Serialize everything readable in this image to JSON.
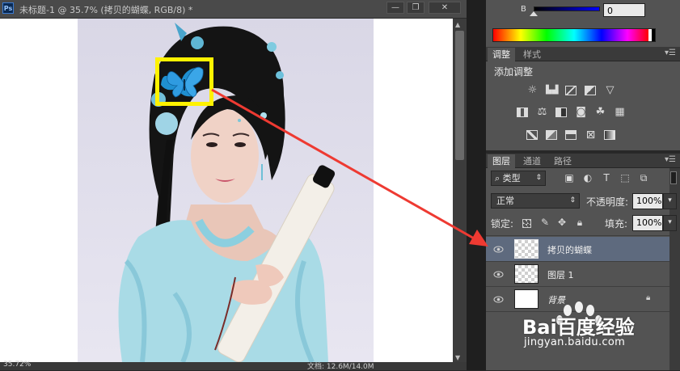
{
  "document": {
    "app_badge": "Ps",
    "title": "未标题-1 @ 35.7% (拷贝的蝴蝶, RGB/8) *",
    "window_buttons": [
      "—",
      "❐",
      "✕"
    ],
    "status_zoom": "35.72%",
    "status_info": "文档: 12.6M/14.0M"
  },
  "color_panel": {
    "channel_label": "B",
    "channel_value": "0"
  },
  "adjustments": {
    "tabs": [
      "调整",
      "样式"
    ],
    "title": "添加调整",
    "icons": [
      "brightness-icon",
      "levels-icon",
      "curves-icon",
      "exposure-icon",
      "vibrance-icon",
      "hue-saturation-icon",
      "color-balance-icon",
      "black-white-icon",
      "photo-filter-icon",
      "channel-mixer-icon",
      "color-lookup-icon",
      "invert-icon",
      "posterize-icon",
      "threshold-icon",
      "selective-color-icon",
      "gradient-map-icon"
    ]
  },
  "layers_panel": {
    "tabs": [
      "图层",
      "通道",
      "路径"
    ],
    "filter_label": "类型",
    "blend_mode": "正常",
    "opacity_label": "不透明度:",
    "opacity_value": "100%",
    "lock_label": "锁定:",
    "fill_label": "填充:",
    "fill_value": "100%",
    "layers": [
      {
        "name": "拷贝的蝴蝶",
        "selected": true,
        "thumb": "transparent"
      },
      {
        "name": "图层 1",
        "selected": false,
        "thumb": "transparent"
      },
      {
        "name": "背景",
        "selected": false,
        "thumb": "white",
        "locked": true
      }
    ]
  },
  "watermark": {
    "brand": "Bai百度经验",
    "url": "jingyan.baidu.com"
  },
  "colors": {
    "highlight_box": "#fff200",
    "arrow": "#ee3a32",
    "selected_layer": "#5e6a7e",
    "panel_bg": "#535353"
  }
}
